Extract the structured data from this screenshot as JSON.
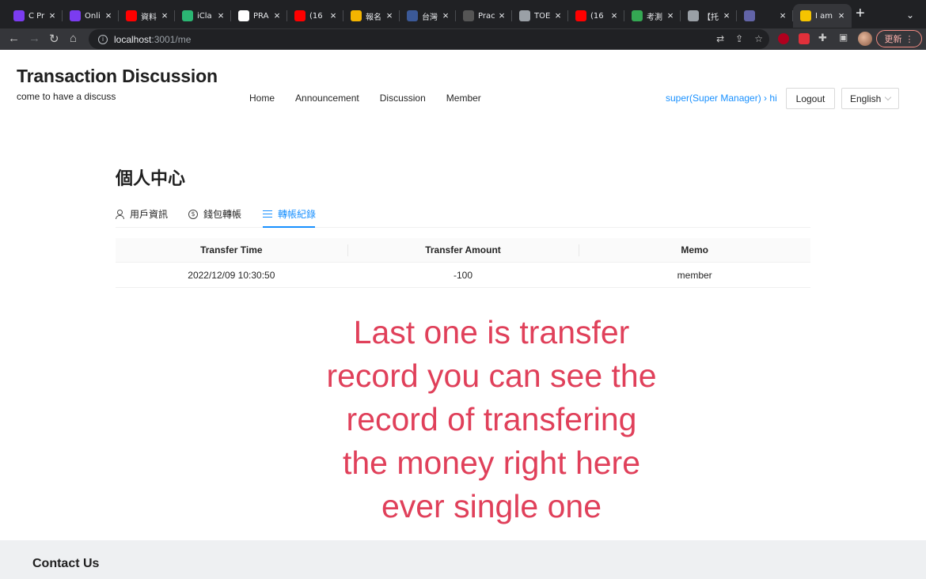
{
  "browser": {
    "tabs": [
      {
        "label": "C Pr",
        "icon": "pen-app-icon",
        "color": "#7b3cf0"
      },
      {
        "label": "Onli",
        "icon": "pen-app-icon",
        "color": "#7b3cf0"
      },
      {
        "label": "資料",
        "icon": "youtube-icon",
        "color": "#ff0000"
      },
      {
        "label": "iCla",
        "icon": "iclass-icon",
        "color": "#2bb673"
      },
      {
        "label": "PRA",
        "icon": "github-icon",
        "color": "#ffffff"
      },
      {
        "label": "(16",
        "icon": "youtube-icon",
        "color": "#ff0000"
      },
      {
        "label": "報名",
        "icon": "photo-icon",
        "color": "#f4b400"
      },
      {
        "label": "台灣",
        "icon": "globe-icon",
        "color": "#3b5998"
      },
      {
        "label": "Prac",
        "icon": "ets-icon",
        "color": "#555555"
      },
      {
        "label": "TOE",
        "icon": "globe-icon",
        "color": "#9aa0a6"
      },
      {
        "label": "(16",
        "icon": "youtube-icon",
        "color": "#ff0000"
      },
      {
        "label": "考測",
        "icon": "leaf-icon",
        "color": "#34a853"
      },
      {
        "label": "【托",
        "icon": "globe-icon",
        "color": "#9aa0a6"
      },
      {
        "label": "",
        "icon": "teams-icon",
        "color": "#6264a7"
      },
      {
        "label": "I am",
        "icon": "fun-icon",
        "color": "#f5c400",
        "active": true
      }
    ],
    "url_host": "localhost",
    "url_path": ":3001/me",
    "update_label": "更新"
  },
  "header": {
    "title": "Transaction Discussion",
    "subtitle": "come to have a discuss",
    "nav": [
      "Home",
      "Announcement",
      "Discussion",
      "Member"
    ],
    "user_link": "super(Super Manager) › hi",
    "logout_label": "Logout",
    "language": "English"
  },
  "profile": {
    "title": "個人中心",
    "tabs": [
      {
        "label": "用戶資訊",
        "icon": "user-icon"
      },
      {
        "label": "錢包轉帳",
        "icon": "dollar-circle-icon"
      },
      {
        "label": "轉帳紀錄",
        "icon": "list-icon",
        "active": true
      }
    ]
  },
  "table": {
    "columns": [
      "Transfer Time",
      "Transfer Amount",
      "Memo"
    ],
    "rows": [
      [
        "2022/12/09 10:30:50",
        "-100",
        "member"
      ]
    ]
  },
  "annotation": {
    "lines": [
      "Last one is transfer",
      "record you can see the",
      "record of transfering",
      "the money right here",
      "ever single one"
    ],
    "color": "#e0405a"
  },
  "footer": {
    "title": "Contact Us"
  },
  "accent_color": "#1890ff"
}
